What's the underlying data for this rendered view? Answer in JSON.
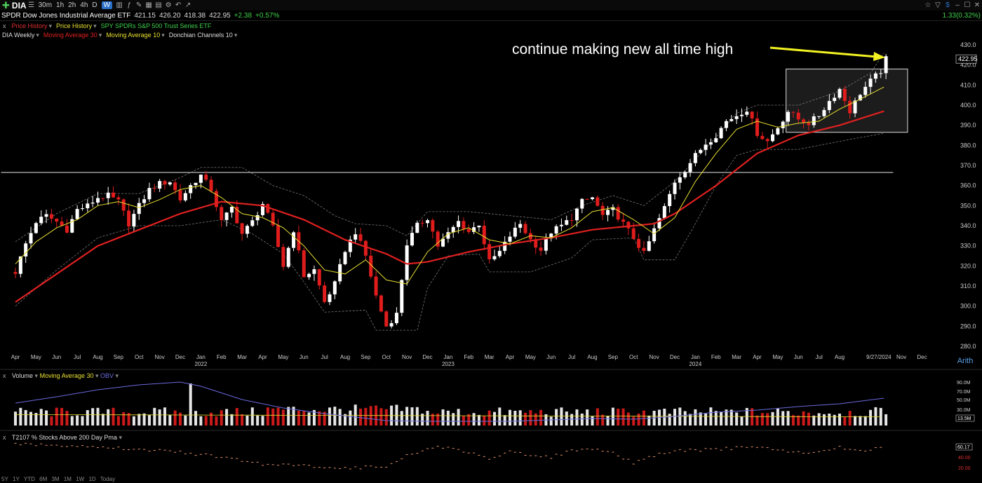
{
  "toolbar": {
    "symbol": "DIA",
    "intervals": [
      "30m",
      "1h",
      "2h",
      "4h",
      "D",
      "W"
    ],
    "selected_interval": "W",
    "right_change": "1.33(0.32%)"
  },
  "quote": {
    "name": "SPDR Dow Jones Industrial Average ETF",
    "open": "421.15",
    "high": "426.20",
    "low": "418.38",
    "close": "422.95",
    "change": "+2.38",
    "change_pct": "+0.57%"
  },
  "overlays": {
    "close_x": "x",
    "items": [
      "Price History",
      "Price History",
      "SPY SPDRs S&P 500 Trust Series ETF"
    ]
  },
  "studies": {
    "items": [
      "DIA Weekly",
      "Moving Average 30",
      "Moving Average 10",
      "Donchian Channels 10"
    ]
  },
  "colors": {
    "up": "#ffffff",
    "down": "#e01c1c",
    "ma30": "#e02020",
    "ma10": "#e8e030",
    "donchian": "#777777",
    "obv": "#6a6adf",
    "annotation_arrow": "#f2f222",
    "pct200": "#e0906a"
  },
  "chart_data": {
    "type": "candlestick",
    "title": "DIA Weekly",
    "x_range": [
      "2021-03",
      "2024-12"
    ],
    "ylim": [
      280,
      430
    ],
    "y_ticks": [
      280,
      290,
      300,
      310,
      320,
      330,
      340,
      350,
      360,
      370,
      380,
      390,
      400,
      410,
      420,
      430
    ],
    "x_labels": [
      {
        "label": "Apr",
        "t": 0.0
      },
      {
        "label": "May",
        "t": 1.0
      },
      {
        "label": "Jun",
        "t": 2.0
      },
      {
        "label": "Jul",
        "t": 3.0
      },
      {
        "label": "Aug",
        "t": 4.0
      },
      {
        "label": "Sep",
        "t": 5.0
      },
      {
        "label": "Oct",
        "t": 6.0
      },
      {
        "label": "Nov",
        "t": 7.0
      },
      {
        "label": "Dec",
        "t": 8.0
      },
      {
        "label": "Jan",
        "t": 9.0
      },
      {
        "label": "Feb",
        "t": 10.0
      },
      {
        "label": "Mar",
        "t": 11.0
      },
      {
        "label": "Apr",
        "t": 12.0
      },
      {
        "label": "May",
        "t": 13.0
      },
      {
        "label": "Jun",
        "t": 14.0
      },
      {
        "label": "Jul",
        "t": 15.0
      },
      {
        "label": "Aug",
        "t": 16.0
      },
      {
        "label": "Sep",
        "t": 17.0
      },
      {
        "label": "Oct",
        "t": 18.0
      },
      {
        "label": "Nov",
        "t": 19.0
      },
      {
        "label": "Dec",
        "t": 20.0
      },
      {
        "label": "Jan",
        "t": 21.0
      },
      {
        "label": "Feb",
        "t": 22.0
      },
      {
        "label": "Mar",
        "t": 23.0
      },
      {
        "label": "Apr",
        "t": 24.0
      },
      {
        "label": "May",
        "t": 25.0
      },
      {
        "label": "Jun",
        "t": 26.0
      },
      {
        "label": "Jul",
        "t": 27.0
      },
      {
        "label": "Aug",
        "t": 28.0
      },
      {
        "label": "Sep",
        "t": 29.0
      },
      {
        "label": "Oct",
        "t": 30.0
      },
      {
        "label": "Nov",
        "t": 31.0
      },
      {
        "label": "Dec",
        "t": 32.0
      },
      {
        "label": "Jan",
        "t": 33.0
      },
      {
        "label": "Feb",
        "t": 34.0
      },
      {
        "label": "Mar",
        "t": 35.0
      },
      {
        "label": "Apr",
        "t": 36.0
      },
      {
        "label": "May",
        "t": 37.0
      },
      {
        "label": "Jun",
        "t": 38.0
      },
      {
        "label": "Jul",
        "t": 39.0
      },
      {
        "label": "Aug",
        "t": 40.0
      },
      {
        "label": "9/27/2024",
        "t": 41.9
      },
      {
        "label": "Nov",
        "t": 43.0
      },
      {
        "label": "Dec",
        "t": 44.0
      }
    ],
    "year_labels": [
      {
        "label": "2022",
        "t": 9.0
      },
      {
        "label": "2023",
        "t": 21.0
      },
      {
        "label": "2024",
        "t": 33.0
      }
    ],
    "annotation": "continue making new all time high",
    "support_line": 366.5,
    "box": {
      "t0": 37.4,
      "t1": 43.3,
      "y0": 386.5,
      "y1": 418
    },
    "close_path": [
      [
        0.0,
        317
      ],
      [
        0.5,
        331
      ],
      [
        1.0,
        342
      ],
      [
        1.5,
        345
      ],
      [
        2.0,
        342
      ],
      [
        2.5,
        338
      ],
      [
        3.0,
        348
      ],
      [
        3.5,
        350
      ],
      [
        4.0,
        354
      ],
      [
        4.5,
        355
      ],
      [
        5.0,
        352
      ],
      [
        5.5,
        341
      ],
      [
        6.0,
        350
      ],
      [
        6.5,
        358
      ],
      [
        7.0,
        361
      ],
      [
        7.5,
        362
      ],
      [
        8.0,
        353
      ],
      [
        8.5,
        360
      ],
      [
        9.0,
        365
      ],
      [
        9.5,
        358
      ],
      [
        10.0,
        342
      ],
      [
        10.5,
        349
      ],
      [
        11.0,
        336
      ],
      [
        11.5,
        342
      ],
      [
        12.0,
        351
      ],
      [
        12.5,
        339
      ],
      [
        13.0,
        320
      ],
      [
        13.5,
        338
      ],
      [
        14.0,
        315
      ],
      [
        14.5,
        318
      ],
      [
        15.0,
        302
      ],
      [
        15.5,
        311
      ],
      [
        16.0,
        328
      ],
      [
        16.5,
        337
      ],
      [
        17.0,
        325
      ],
      [
        17.5,
        305
      ],
      [
        18.0,
        290
      ],
      [
        18.5,
        296
      ],
      [
        19.0,
        331
      ],
      [
        19.5,
        340
      ],
      [
        20.0,
        344
      ],
      [
        20.5,
        330
      ],
      [
        21.0,
        336
      ],
      [
        21.5,
        342
      ],
      [
        22.0,
        337
      ],
      [
        22.5,
        341
      ],
      [
        23.0,
        322
      ],
      [
        23.5,
        327
      ],
      [
        24.0,
        335
      ],
      [
        24.5,
        341
      ],
      [
        25.0,
        333
      ],
      [
        25.5,
        328
      ],
      [
        26.0,
        337
      ],
      [
        26.5,
        340
      ],
      [
        27.0,
        344
      ],
      [
        27.5,
        352
      ],
      [
        28.0,
        354
      ],
      [
        28.5,
        345
      ],
      [
        29.0,
        348
      ],
      [
        29.5,
        341
      ],
      [
        30.0,
        334
      ],
      [
        30.5,
        326
      ],
      [
        31.0,
        338
      ],
      [
        31.5,
        349
      ],
      [
        32.0,
        362
      ],
      [
        32.5,
        368
      ],
      [
        33.0,
        375
      ],
      [
        33.5,
        381
      ],
      [
        34.0,
        385
      ],
      [
        34.5,
        392
      ],
      [
        35.0,
        395
      ],
      [
        35.5,
        398
      ],
      [
        36.0,
        386
      ],
      [
        36.5,
        382
      ],
      [
        37.0,
        389
      ],
      [
        37.5,
        397
      ],
      [
        38.0,
        393
      ],
      [
        38.5,
        391
      ],
      [
        39.0,
        395
      ],
      [
        39.5,
        402
      ],
      [
        40.0,
        408
      ],
      [
        40.5,
        397
      ],
      [
        41.0,
        406
      ],
      [
        41.5,
        412
      ],
      [
        42.0,
        417
      ],
      [
        42.15,
        422.95
      ]
    ],
    "ma10_path": [
      [
        0.0,
        321
      ],
      [
        1.0,
        332
      ],
      [
        2.0,
        339
      ],
      [
        3.0,
        343
      ],
      [
        4.0,
        350
      ],
      [
        5.0,
        352
      ],
      [
        6.0,
        349
      ],
      [
        7.0,
        353
      ],
      [
        8.0,
        358
      ],
      [
        9.0,
        360
      ],
      [
        10.0,
        354
      ],
      [
        11.0,
        346
      ],
      [
        12.0,
        344
      ],
      [
        13.0,
        339
      ],
      [
        14.0,
        330
      ],
      [
        15.0,
        318
      ],
      [
        16.0,
        316
      ],
      [
        17.0,
        323
      ],
      [
        18.0,
        313
      ],
      [
        19.0,
        311
      ],
      [
        20.0,
        327
      ],
      [
        21.0,
        336
      ],
      [
        22.0,
        339
      ],
      [
        23.0,
        333
      ],
      [
        24.0,
        331
      ],
      [
        25.0,
        335
      ],
      [
        26.0,
        334
      ],
      [
        27.0,
        339
      ],
      [
        28.0,
        347
      ],
      [
        29.0,
        349
      ],
      [
        30.0,
        343
      ],
      [
        31.0,
        336
      ],
      [
        32.0,
        344
      ],
      [
        33.0,
        362
      ],
      [
        34.0,
        376
      ],
      [
        35.0,
        388
      ],
      [
        36.0,
        392
      ],
      [
        37.0,
        389
      ],
      [
        38.0,
        391
      ],
      [
        39.0,
        392
      ],
      [
        40.0,
        398
      ],
      [
        41.0,
        403
      ],
      [
        42.15,
        409
      ]
    ],
    "ma30_path": [
      [
        0.0,
        302
      ],
      [
        2.0,
        316
      ],
      [
        4.0,
        330
      ],
      [
        6.0,
        338
      ],
      [
        8.0,
        346
      ],
      [
        10.0,
        352
      ],
      [
        12.0,
        350
      ],
      [
        14.0,
        343
      ],
      [
        16.0,
        333
      ],
      [
        18.0,
        326
      ],
      [
        19.0,
        321
      ],
      [
        20.0,
        322
      ],
      [
        22.0,
        327
      ],
      [
        24.0,
        331
      ],
      [
        26.0,
        334
      ],
      [
        28.0,
        338
      ],
      [
        30.0,
        340
      ],
      [
        31.0,
        341
      ],
      [
        32.0,
        346
      ],
      [
        34.0,
        360
      ],
      [
        36.0,
        376
      ],
      [
        38.0,
        385
      ],
      [
        40.0,
        390
      ],
      [
        42.15,
        397
      ]
    ],
    "donchian_upper": [
      [
        0.0,
        332
      ],
      [
        2.0,
        346
      ],
      [
        4.0,
        356
      ],
      [
        6.0,
        356
      ],
      [
        8.0,
        364
      ],
      [
        9.0,
        369
      ],
      [
        11.0,
        369
      ],
      [
        12.5,
        360
      ],
      [
        14.0,
        355
      ],
      [
        15.5,
        345
      ],
      [
        16.5,
        341
      ],
      [
        18.0,
        340
      ],
      [
        19.0,
        335
      ],
      [
        20.0,
        347
      ],
      [
        22.0,
        347
      ],
      [
        24.0,
        345
      ],
      [
        26.0,
        343
      ],
      [
        27.5,
        350
      ],
      [
        29.0,
        355
      ],
      [
        30.5,
        350
      ],
      [
        32.0,
        362
      ],
      [
        34.0,
        384
      ],
      [
        35.0,
        396
      ],
      [
        36.0,
        400
      ],
      [
        38.0,
        400
      ],
      [
        40.0,
        407
      ],
      [
        41.5,
        416
      ],
      [
        42.15,
        426
      ]
    ],
    "donchian_lower": [
      [
        0.0,
        300
      ],
      [
        2.0,
        318
      ],
      [
        4.0,
        334
      ],
      [
        6.0,
        340
      ],
      [
        8.0,
        340
      ],
      [
        10.0,
        343
      ],
      [
        11.5,
        336
      ],
      [
        13.0,
        326
      ],
      [
        14.0,
        312
      ],
      [
        15.0,
        297
      ],
      [
        17.0,
        298
      ],
      [
        17.5,
        288
      ],
      [
        19.5,
        288
      ],
      [
        20.0,
        309
      ],
      [
        21.0,
        325
      ],
      [
        22.5,
        326
      ],
      [
        23.0,
        317
      ],
      [
        25.0,
        317
      ],
      [
        27.0,
        324
      ],
      [
        28.0,
        333
      ],
      [
        30.0,
        334
      ],
      [
        30.5,
        323
      ],
      [
        32.0,
        323
      ],
      [
        33.0,
        341
      ],
      [
        34.0,
        360
      ],
      [
        35.0,
        375
      ],
      [
        36.0,
        378
      ],
      [
        38.0,
        378
      ],
      [
        40.0,
        382
      ],
      [
        42.15,
        386
      ]
    ],
    "volume": {
      "label": "Volume",
      "ma_label": "Moving Average 30",
      "obv_label": "OBV",
      "y_ticks": [
        "90.0M",
        "70.0M",
        "50.0M",
        "30.0M"
      ],
      "last": "13.5M"
    },
    "breadth": {
      "label": "T2107 % Stocks Above 200 Day Pma",
      "last": "60.17",
      "y_ticks": [
        "40.00",
        "20.00"
      ]
    },
    "price_tag": "422.95",
    "scale_mode": "Arith"
  },
  "range_buttons": [
    "5Y",
    "1Y",
    "YTD",
    "6M",
    "3M",
    "1M",
    "1W",
    "1D",
    "Today"
  ]
}
